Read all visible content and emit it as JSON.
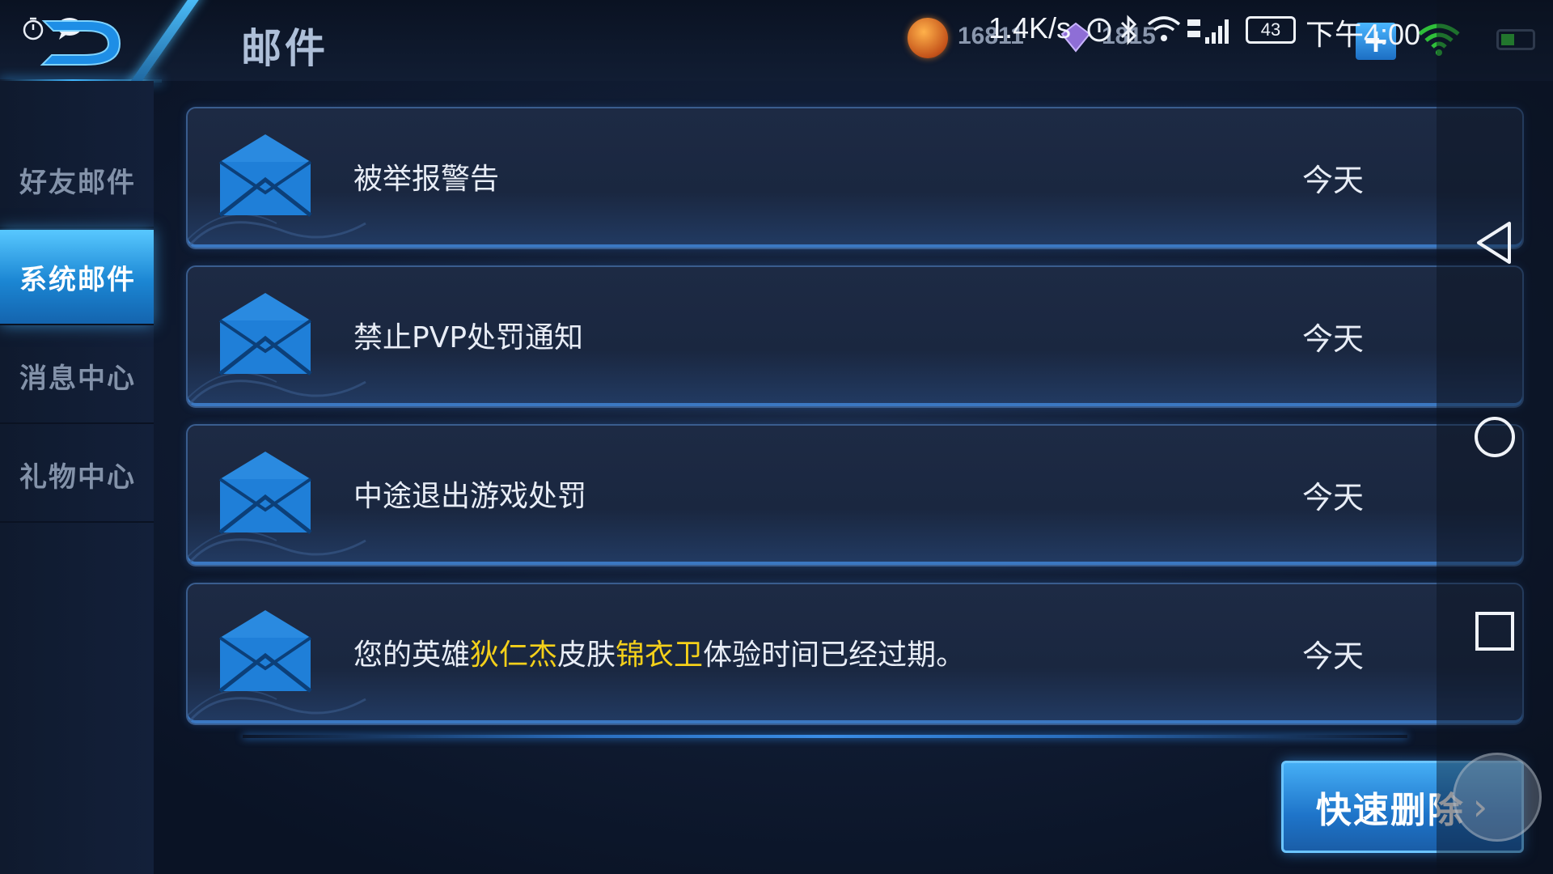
{
  "header": {
    "title": "邮件"
  },
  "currency": {
    "coin_amount": "16811",
    "gem_amount": "1815",
    "plus_label": "+"
  },
  "phone_status": {
    "net_speed": "1.4K/s",
    "battery_level": "43",
    "time": "下午4:00"
  },
  "sidebar": {
    "items": [
      {
        "label": "好友邮件",
        "active": false
      },
      {
        "label": "系统邮件",
        "active": true
      },
      {
        "label": "消息中心",
        "active": false
      },
      {
        "label": "礼物中心",
        "active": false
      }
    ]
  },
  "mails": [
    {
      "title": "被举报警告",
      "date": "今天"
    },
    {
      "title": "禁止PVP处罚通知",
      "date": "今天"
    },
    {
      "title": "中途退出游戏处罚",
      "date": "今天"
    },
    {
      "title_parts": [
        "您的英雄",
        "狄仁杰",
        "皮肤",
        "锦衣卫",
        "体验时间已经过期。"
      ],
      "date": "今天"
    }
  ],
  "actions": {
    "quick_delete_label": "快速删除",
    "quick_delete_chevron": "›"
  },
  "colors": {
    "accent": "#3fb6ff",
    "highlight_text": "#f4d01a",
    "envelope": "#1f7fd8",
    "active_tab": "#1b86d3"
  },
  "icons": {
    "clock": "clock-icon",
    "chat": "chat-bubble-icon",
    "coin": "gold-coin-icon",
    "gem": "diamond-icon",
    "envelope": "envelope-icon",
    "back": "back-triangle-icon",
    "home": "home-circle-icon",
    "recent": "recent-apps-square-icon"
  }
}
